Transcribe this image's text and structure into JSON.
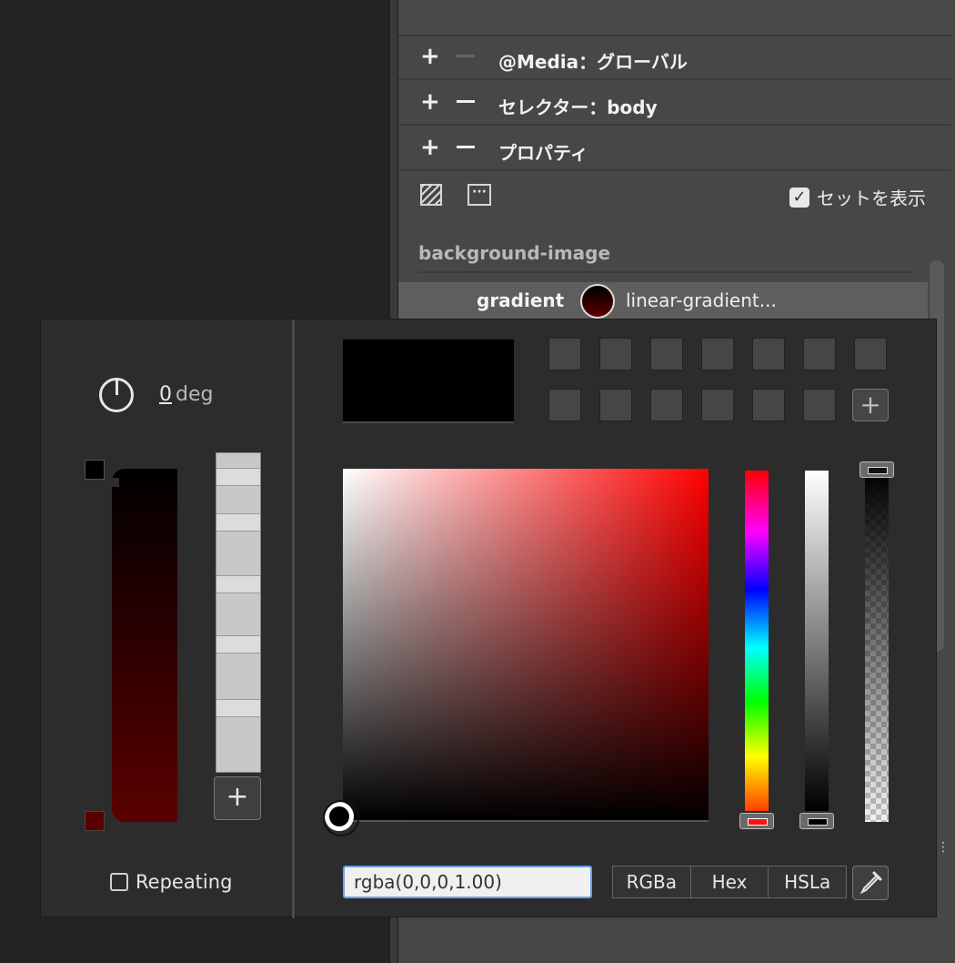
{
  "rule_rows": [
    {
      "label": "@Media：グローバル",
      "minus_enabled": false
    },
    {
      "label": "セレクター：body",
      "minus_enabled": true
    },
    {
      "label": "プロパティ",
      "minus_enabled": true
    }
  ],
  "toolbar": {
    "more_glyph": "···",
    "show_set_check": "✓",
    "show_set_label": "セットを表示"
  },
  "property": {
    "heading": "background-image",
    "name": "gradient",
    "value": "linear-gradient..."
  },
  "gradient_editor": {
    "angle_value": "0",
    "angle_unit": "deg",
    "add_stop_label": "+",
    "repeating_label": "Repeating",
    "colors": {
      "stop_top": "#000000",
      "stop_bottom": "#5a0000"
    }
  },
  "color_picker": {
    "add_swatch_label": "+",
    "current_value": "rgba(0,0,0,1.00)",
    "modes": [
      "RGBa",
      "Hex",
      "HSLa"
    ],
    "preview_color": "#000000"
  }
}
